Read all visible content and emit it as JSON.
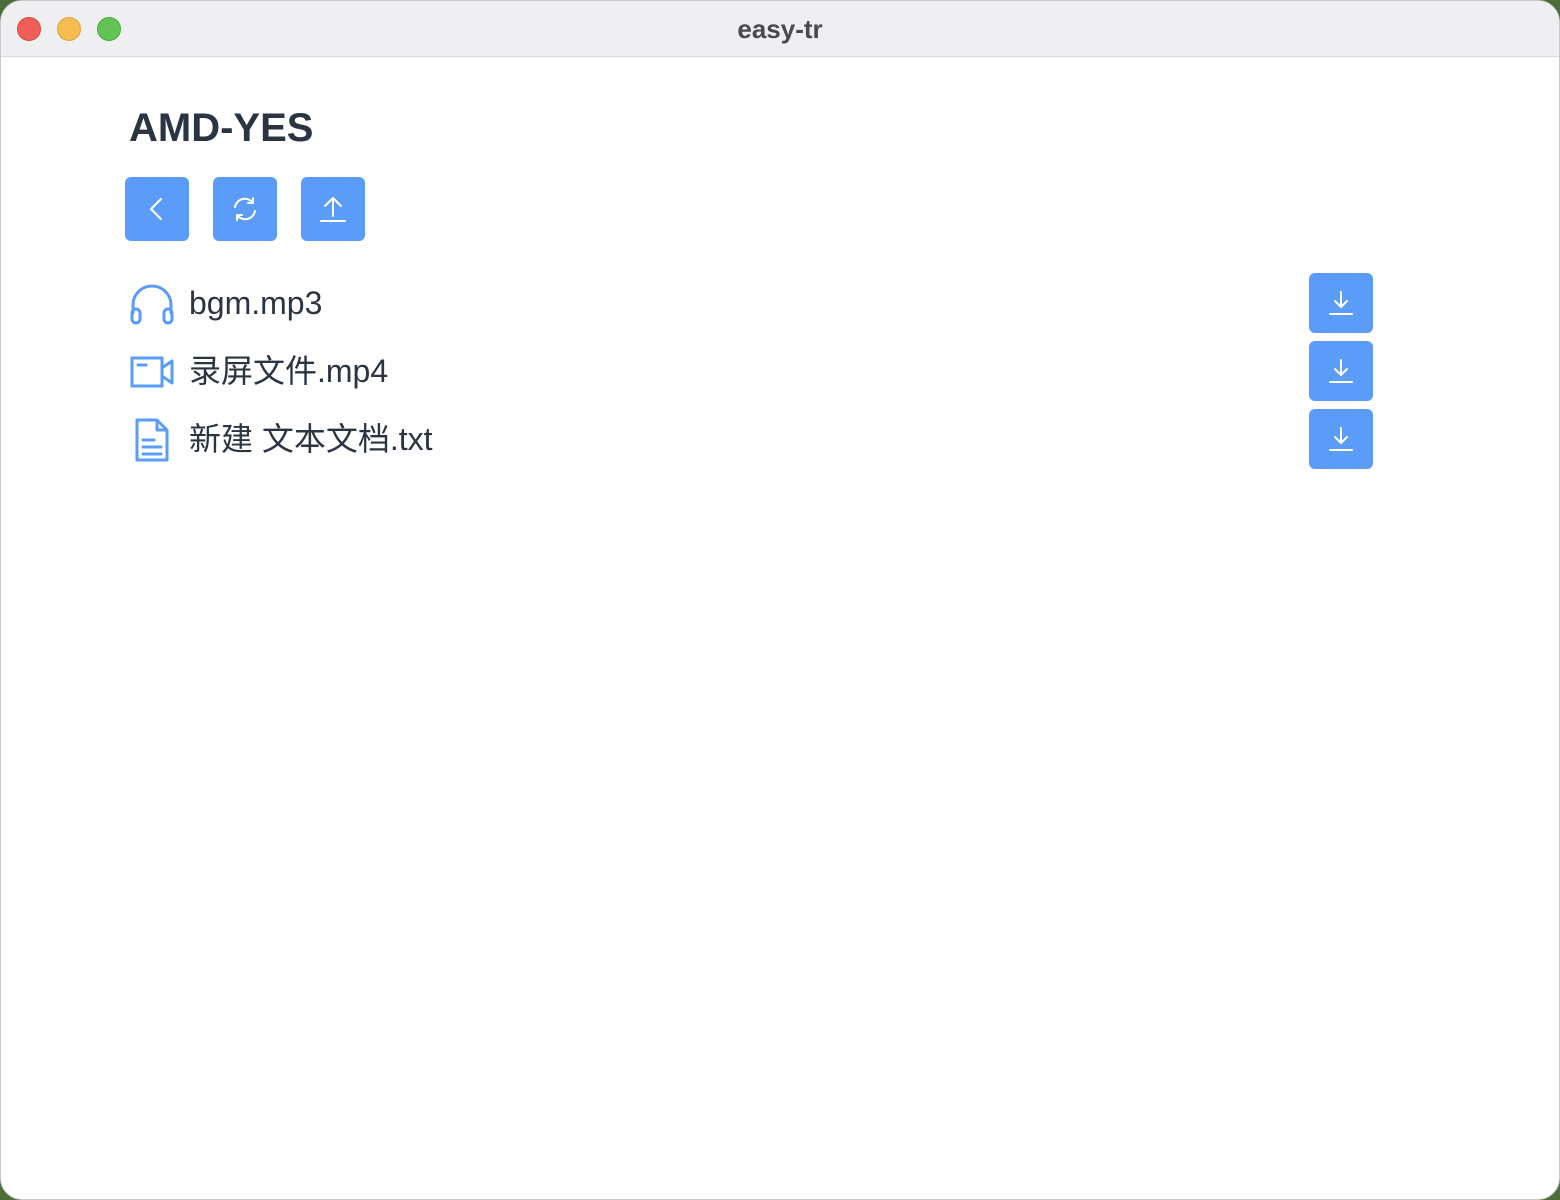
{
  "window": {
    "title": "easy-tr"
  },
  "folder": {
    "title": "AMD-YES"
  },
  "toolbar": {
    "back_icon": "chevron-left-icon",
    "refresh_icon": "refresh-icon",
    "upload_icon": "upload-icon"
  },
  "files": [
    {
      "name": "bgm.mp3",
      "icon": "headphones-icon",
      "action_icon": "download-icon"
    },
    {
      "name": "录屏文件.mp4",
      "icon": "video-camera-icon",
      "action_icon": "download-icon"
    },
    {
      "name": "新建 文本文档.txt",
      "icon": "document-icon",
      "action_icon": "download-icon"
    }
  ],
  "colors": {
    "accent": "#5a9cf8",
    "text": "#2b3442",
    "titlebar": "#efeff2"
  }
}
